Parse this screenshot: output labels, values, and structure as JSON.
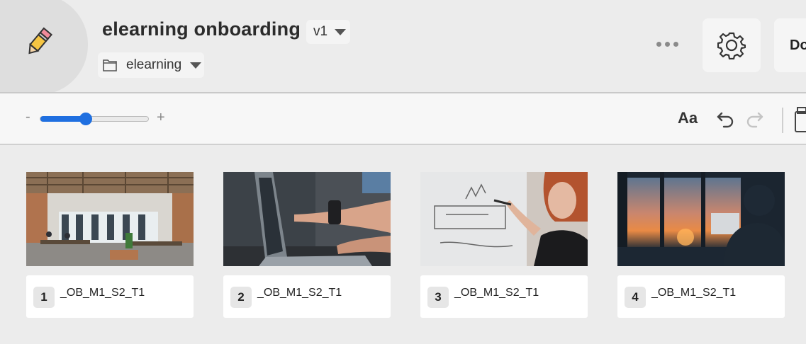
{
  "header": {
    "title": "elearning onboarding",
    "version": "v1",
    "folder": "elearning",
    "done_label": "Do",
    "logo_icon": "pencil-icon",
    "settings_icon": "gear-icon",
    "more_icon": "more-dots-icon"
  },
  "toolbar": {
    "zoom_minus": "-",
    "zoom_plus": "+",
    "zoom_level": 0.42,
    "text_style_label": "Aa",
    "undo_icon": "undo-icon",
    "redo_icon": "redo-icon",
    "accent_color": "#1f6fe0"
  },
  "cards": [
    {
      "number": "1",
      "label": "_OB_M1_S2_T1",
      "image": "office-photo"
    },
    {
      "number": "2",
      "label": "_OB_M1_S2_T1",
      "image": "laptop-photo"
    },
    {
      "number": "3",
      "label": "_OB_M1_S2_T1",
      "image": "whiteboard-photo"
    },
    {
      "number": "4",
      "label": "_OB_M1_S2_T1",
      "image": "sunset-window-photo"
    }
  ]
}
